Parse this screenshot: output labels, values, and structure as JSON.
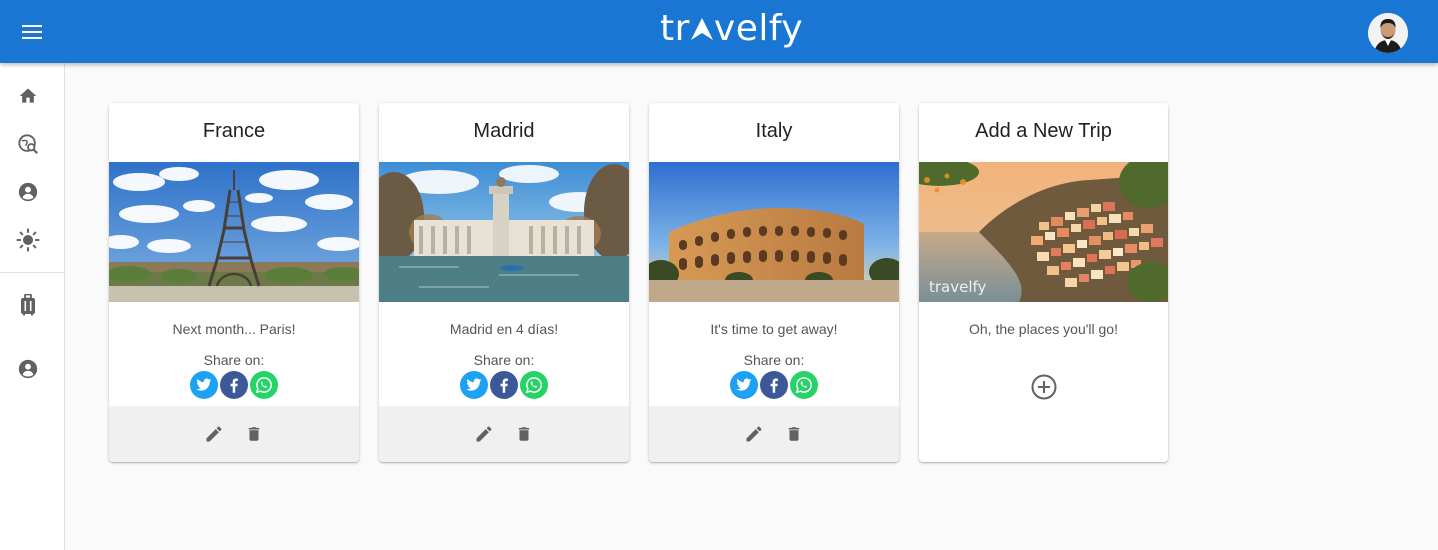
{
  "header": {
    "logo_left": "tr",
    "logo_right": "velfy",
    "colors": {
      "appbar": "#1976d2"
    }
  },
  "sidebar": {
    "items": [
      {
        "name": "home",
        "icon": "home-icon"
      },
      {
        "name": "explore",
        "icon": "travel-explore-icon"
      },
      {
        "name": "account",
        "icon": "account-circle-icon"
      },
      {
        "name": "theme",
        "icon": "sun-icon"
      },
      {
        "name": "trips",
        "icon": "luggage-icon"
      },
      {
        "name": "profile",
        "icon": "account-circle-icon"
      }
    ]
  },
  "cards": [
    {
      "title": "France",
      "text": "Next month... Paris!",
      "share_label": "Share on:"
    },
    {
      "title": "Madrid",
      "text": "Madrid en 4 días!",
      "share_label": "Share on:"
    },
    {
      "title": "Italy",
      "text": "It's time to get away!",
      "share_label": "Share on:"
    },
    {
      "title": "Add a New Trip",
      "text": "Oh, the places you'll go!",
      "watermark": "travelfy"
    }
  ],
  "social": {
    "twitter": "#1da1f2",
    "facebook": "#3b5998",
    "whatsapp": "#25d366"
  }
}
